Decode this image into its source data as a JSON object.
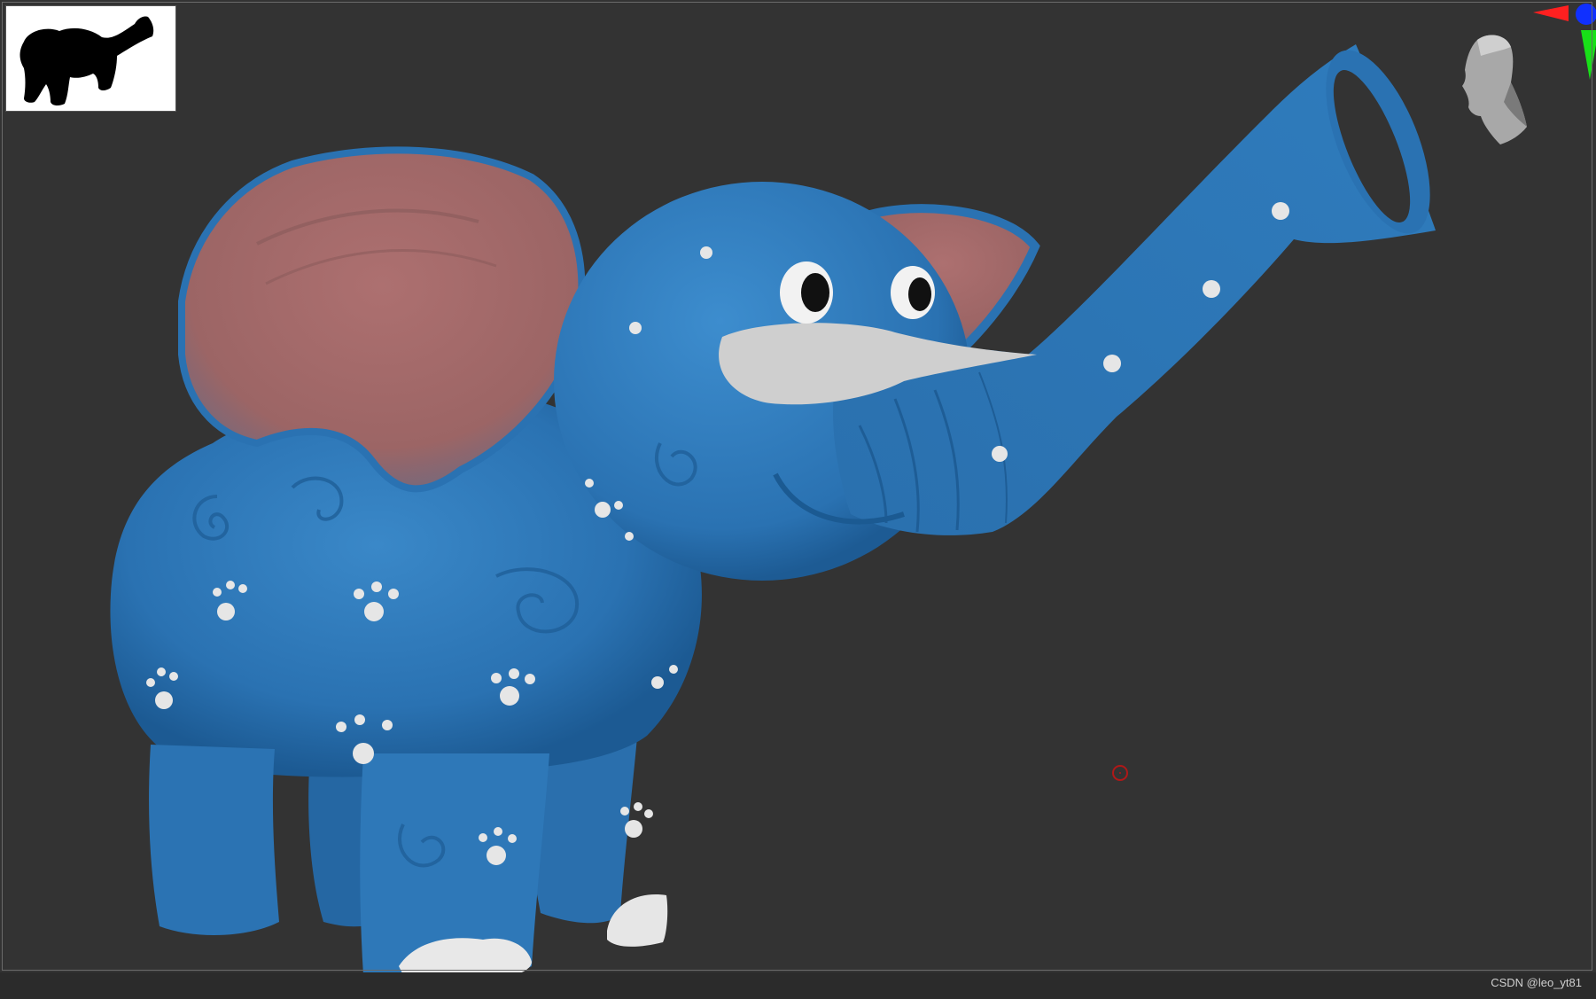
{
  "viewport": {
    "background": "#333333",
    "model_color": "#2e78b8",
    "ear_color": "#a66a6a",
    "accent_color": "#e6e6e6"
  },
  "thumbnail": {
    "icon": "elephant-silhouette-icon"
  },
  "gizmo": {
    "icon": "axis-gizmo-icon",
    "x_color": "#ff2020",
    "y_color": "#18e018",
    "z_color": "#1030ff"
  },
  "navigation": {
    "icon": "head-navigation-icon"
  },
  "cursor": {
    "icon": "brush-cursor-icon",
    "color": "#b01818"
  },
  "watermark": {
    "text": "CSDN @leo_yt81"
  }
}
